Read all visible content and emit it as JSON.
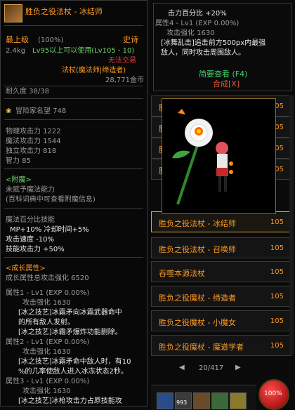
{
  "tooltip": {
    "title": "胜负之役法杖 - 冰结师",
    "rarity": "史诗",
    "level_req": "最上级",
    "level_pct": "(100%)",
    "weight": "2.4kg",
    "usable": "Lv95以上可以使用(Lv105 - 10)",
    "no_trade": "无法交易",
    "type_label": "法杖(魔法师|缔造者)",
    "gold": "28,771金币",
    "durability": "耐久度 38/38",
    "adventure_fame": "冒险家名望 748",
    "stats": [
      "物理攻击力 1222",
      "魔法攻击力 1544",
      "独立攻击力 818",
      "智力 85"
    ],
    "enchant_header": "<附魔>",
    "enchant_none": "未赋予魔法能力",
    "enchant_hint": "(百科词典中可查看附魔信息)",
    "skill_title": "魔法百分比技能",
    "skill_line": "MP+10% 冷却时间+5%",
    "attack_speed": "攻击速度 -10%",
    "skill_attack": "技能攻击力 +50%",
    "growth_header": "<成长属性>",
    "growth_total": "成长属性总攻击强化 6520",
    "growth": [
      {
        "header": "属性1 - Lv1 (EXP 0.00%)",
        "attack": "攻击强化 1630",
        "lines": [
          "[冰之技艺]冰霜矛向冰霜武器命中",
          "的所有敌人发射。",
          "[冰之技艺]冰霜矛爆炸功能删除。"
        ]
      },
      {
        "header": "属性2 - Lv1 (EXP 0.00%)",
        "attack": "攻击强化 1630",
        "lines": [
          "[冰之技艺]冰霜矛命中敌人时，有10",
          "%的几率使敌人进入冰冻状态2秒。"
        ]
      },
      {
        "header": "属性3 - Lv1 (EXP 0.00%)",
        "attack": "攻击强化 1630",
        "lines": [
          "[冰之技艺]冰枪攻击力占原技能攻"
        ]
      }
    ]
  },
  "top_right": {
    "line1": "击力百分比 +20%",
    "line2": "属性4 - Lv1 (EXP 0.00%)",
    "line3": "攻击强化 1630",
    "line4": "[冰舞乱击]追击前方500px内最强",
    "line5": "敌人，同时攻击周围敌人。",
    "brief": "简要查看 (F4)",
    "synth": "合成[X]"
  },
  "list": [
    {
      "name": "胜",
      "level": "105"
    },
    {
      "name": "胜",
      "level": "105"
    },
    {
      "name": "胜",
      "level": "105"
    },
    {
      "name": "胜",
      "level": "105"
    },
    {
      "name": "胜负之役法杖 - 冰结师",
      "level": "105"
    },
    {
      "name": "胜负之役法杖 - 召唤师",
      "level": "105"
    },
    {
      "name": "吞噬本源法杖",
      "level": "105"
    },
    {
      "name": "胜负之役魔杖 - 缔造者",
      "level": "105"
    },
    {
      "name": "胜负之役魔杖 - 小魔女",
      "level": "105"
    },
    {
      "name": "胜负之役魔杖 - 魔道学者",
      "level": "105"
    }
  ],
  "pager": "20/417",
  "hp": "100%",
  "hotkey_count": "993"
}
